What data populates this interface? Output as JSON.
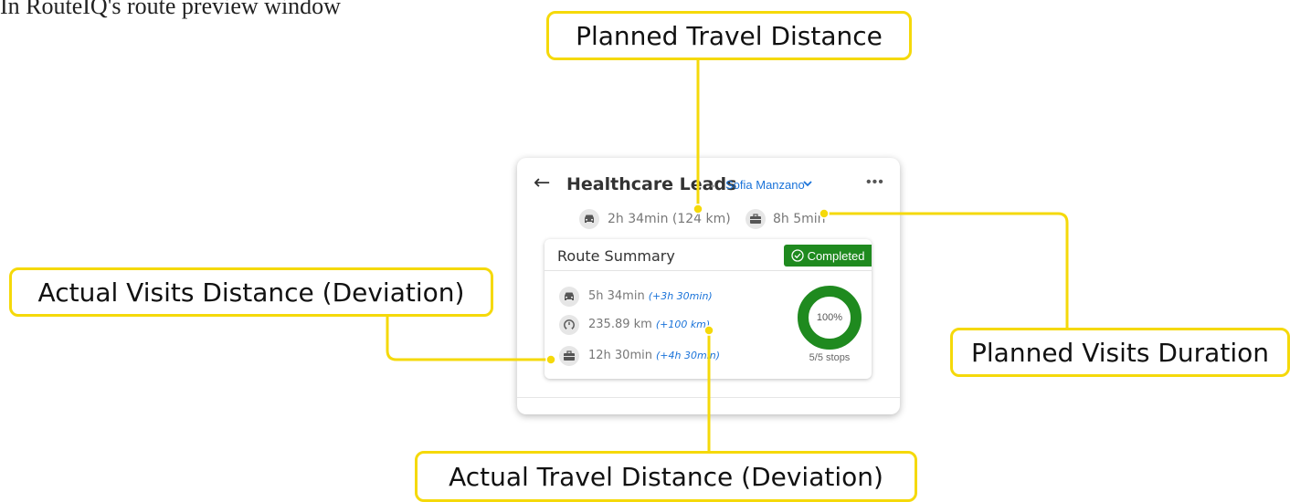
{
  "caption": "In RouteIQ's route preview window",
  "callouts": {
    "planned_travel_distance": "Planned Travel Distance",
    "actual_visits_distance": "Actual Visits Distance (Deviation)",
    "planned_visits_duration": "Planned Visits Duration",
    "actual_travel_distance": "Actual Travel Distance (Deviation)"
  },
  "panel": {
    "back_icon": "arrow-left-icon",
    "title": "Healthcare Leads",
    "assignee": "Sofia Manzano",
    "more_icon": "more-horizontal-icon",
    "planned_travel": "2h 34min (124 km)",
    "planned_visits": "8h 5min"
  },
  "summary": {
    "title": "Route Summary",
    "status": "Completed",
    "rows": [
      {
        "icon": "car-icon",
        "value": "5h 34min",
        "deviation": "(+3h 30min)"
      },
      {
        "icon": "speedometer-icon",
        "value": "235.89 km",
        "deviation": "(+100 km)"
      },
      {
        "icon": "briefcase-icon",
        "value": "12h 30min",
        "deviation": "(+4h 30min)"
      }
    ],
    "progress_label": "100%",
    "progress_fraction": 1.0,
    "stops": "5/5 stops"
  },
  "colors": {
    "callout_border": "#f5d90a",
    "completed": "#1f8a1f",
    "link": "#1a73d9",
    "donut": "#1f8a1f"
  }
}
